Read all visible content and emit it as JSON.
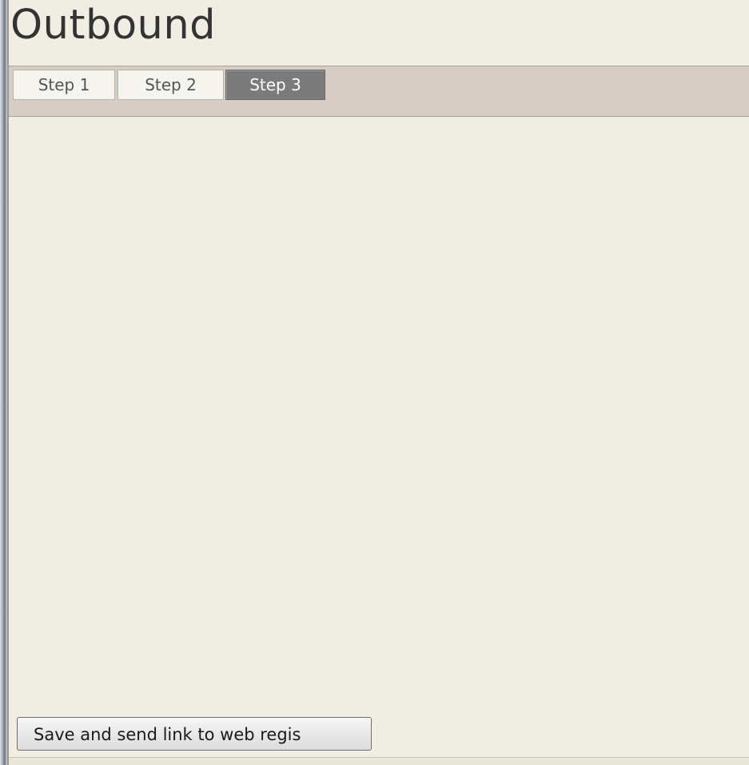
{
  "page": {
    "title": "Outbound"
  },
  "tabs": [
    {
      "label": "Step 1",
      "selected": false
    },
    {
      "label": "Step 2",
      "selected": false
    },
    {
      "label": "Step 3",
      "selected": true
    }
  ],
  "actions": {
    "save_label": "Save and send link to web regis"
  },
  "colors": {
    "background": "#f0eee2",
    "tabbar": "#d6cdc4",
    "selected_tab": "#7b7b7b",
    "title_text": "#333333"
  }
}
